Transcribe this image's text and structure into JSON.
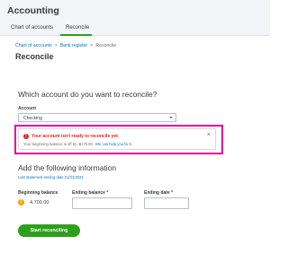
{
  "app": {
    "title": "Accounting"
  },
  "tabs": [
    {
      "label": "Chart of accounts",
      "active": false
    },
    {
      "label": "Reconcile",
      "active": true
    }
  ],
  "breadcrumb": {
    "items": [
      "Chart of accounts",
      "Bank register",
      "Reconcile"
    ],
    "separator": ">"
  },
  "page": {
    "title": "Reconcile"
  },
  "account_section": {
    "question": "Which account do you want to reconcile?",
    "account_label": "Account",
    "account_value": "Checking"
  },
  "alert": {
    "title": "Your account isn't ready to reconcile yet.",
    "body": "Your beginning balance is off by -$175.00.",
    "link": "We can help you fix it.",
    "close": "×",
    "icon": "error-icon",
    "color": "#d52b1e",
    "highlight_color": "#e5059a"
  },
  "info_section": {
    "title": "Add the following information",
    "subtitle": "Last statement ending date 01/31/2022",
    "beginning_balance_label": "Beginning balance",
    "beginning_balance_value": "4,700.00",
    "ending_balance_label": "Ending balance *",
    "ending_date_label": "Ending date *",
    "warning_icon": "warning-icon"
  },
  "primary_button": {
    "label": "Start reconciling",
    "color": "#2ca01c"
  }
}
